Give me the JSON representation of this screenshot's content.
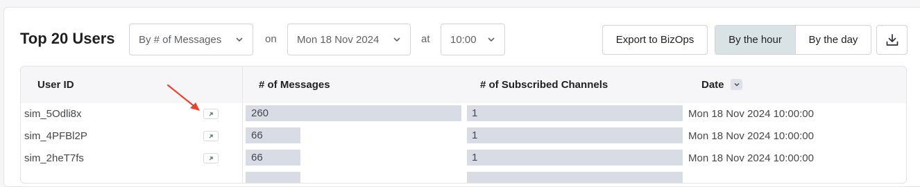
{
  "header": {
    "title": "Top 20 Users",
    "metric_select": "By # of Messages",
    "on_label": "on",
    "date_select": "Mon 18 Nov 2024",
    "at_label": "at",
    "time_select": "10:00",
    "export_label": "Export to BizOps",
    "granularity": {
      "hour_label": "By the hour",
      "day_label": "By the day",
      "selected": "By the hour"
    }
  },
  "table": {
    "columns": [
      "User ID",
      "# of Messages",
      "# of Subscribed Channels",
      "Date"
    ],
    "rows": [
      {
        "user_id": "sim_5Odli8x",
        "messages": "260",
        "messages_fraction": 1.0,
        "channels": "1",
        "channels_fraction": 1.0,
        "date": "Mon 18 Nov 2024 10:00:00"
      },
      {
        "user_id": "sim_4PFBl2P",
        "messages": "66",
        "messages_fraction": 0.254,
        "channels": "1",
        "channels_fraction": 1.0,
        "date": "Mon 18 Nov 2024 10:00:00"
      },
      {
        "user_id": "sim_2heT7fs",
        "messages": "66",
        "messages_fraction": 0.254,
        "channels": "1",
        "channels_fraction": 1.0,
        "date": "Mon 18 Nov 2024 10:00:00"
      },
      {
        "user_id": "",
        "messages": "",
        "messages_fraction": 0.254,
        "channels": "",
        "channels_fraction": 1.0,
        "date": ""
      }
    ]
  },
  "icons": {
    "chevron": "chevron-down-icon",
    "download": "download-icon",
    "open_link": "external-link-icon",
    "sort": "sort-down-icon",
    "annotation": "red-arrow-icon"
  },
  "colors": {
    "selected_segment": "#d9e3e6",
    "bar": "#d8dce4",
    "annotation_arrow": "#e8412c"
  }
}
